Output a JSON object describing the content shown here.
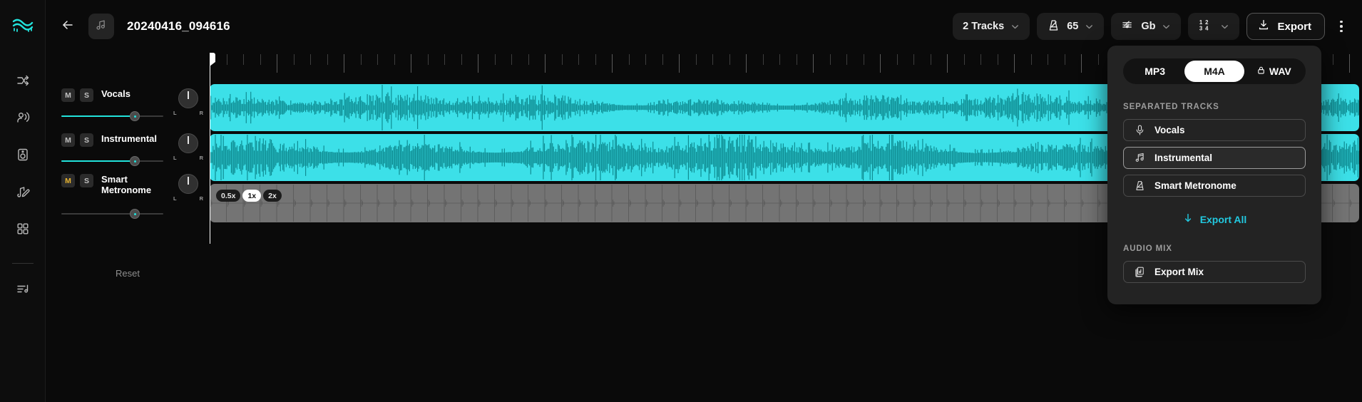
{
  "app": {
    "logo_icon": "waveform-logo-icon",
    "accent": "#22e3dc",
    "clip_color": "#3ce0e8",
    "metronome_clip_color": "#747474"
  },
  "rail": {
    "items": [
      {
        "icon": "share-arrows-icon",
        "name": "sidebar-item-share"
      },
      {
        "icon": "voice-person-icon",
        "name": "sidebar-item-voice"
      },
      {
        "icon": "speaker-icon",
        "name": "sidebar-item-speaker"
      },
      {
        "icon": "note-edit-icon",
        "name": "sidebar-item-edit"
      },
      {
        "icon": "grid-apps-icon",
        "name": "sidebar-item-apps"
      },
      {
        "icon": "playlist-note-icon",
        "name": "sidebar-item-playlist"
      }
    ]
  },
  "header": {
    "back_icon": "back-arrow-icon",
    "file_icon": "music-note-icon",
    "title": "20240416_094616",
    "controls": [
      {
        "label": "2 Tracks",
        "icon": null,
        "name": "tracks-selector"
      },
      {
        "label": "65",
        "icon": "metronome-icon",
        "name": "tempo-selector"
      },
      {
        "label": "Gb",
        "icon": "key-signature-icon",
        "name": "key-selector"
      },
      {
        "label": "",
        "icon": "time-signature-icon",
        "name": "time-signature-selector"
      }
    ],
    "export_label": "Export",
    "export_icon": "download-icon",
    "more_icon": "more-vertical-icon"
  },
  "tracks": [
    {
      "name": "Vocals",
      "mute_label": "M",
      "solo_label": "S",
      "muted": false,
      "volume_pct": 72,
      "pan_left": "L",
      "pan_right": "R"
    },
    {
      "name": "Instrumental",
      "mute_label": "M",
      "solo_label": "S",
      "muted": false,
      "volume_pct": 72,
      "pan_left": "L",
      "pan_right": "R"
    },
    {
      "name": "Smart Metronome",
      "mute_label": "M",
      "solo_label": "S",
      "muted": true,
      "volume_pct": 72,
      "pan_left": "L",
      "pan_right": "R"
    }
  ],
  "reset_label": "Reset",
  "speed": {
    "options": [
      "0.5x",
      "1x",
      "2x"
    ],
    "selected": "1x"
  },
  "export_menu": {
    "formats": [
      {
        "label": "MP3",
        "locked": false
      },
      {
        "label": "M4A",
        "locked": false
      },
      {
        "label": "WAV",
        "locked": true
      }
    ],
    "selected_format": "M4A",
    "separated_label": "SEPARATED TRACKS",
    "separated_items": [
      {
        "label": "Vocals",
        "icon": "microphone-icon",
        "hover": false
      },
      {
        "label": "Instrumental",
        "icon": "music-notes-icon",
        "hover": true
      },
      {
        "label": "Smart Metronome",
        "icon": "metronome-icon",
        "hover": false
      }
    ],
    "export_all_label": "Export All",
    "export_all_icon": "download-arrow-icon",
    "audio_mix_label": "AUDIO MIX",
    "export_mix_label": "Export Mix",
    "export_mix_icon": "stacked-files-icon"
  }
}
